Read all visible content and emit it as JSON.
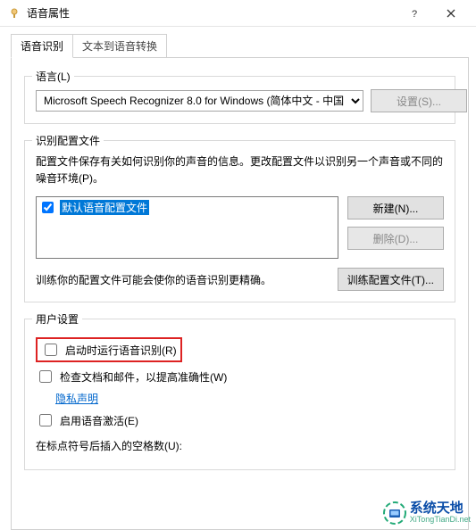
{
  "window": {
    "title": "语音属性"
  },
  "tabs": {
    "active": "语音识别",
    "inactive": "文本到语音转换"
  },
  "language_group": {
    "legend": "语言(L)",
    "recognizer": "Microsoft Speech Recognizer 8.0 for Windows (简体中文 - 中国",
    "settings_btn": "设置(S)..."
  },
  "profile_group": {
    "legend": "识别配置文件",
    "description": "配置文件保存有关如何识别你的声音的信息。更改配置文件以识别另一个声音或不同的噪音环境(P)。",
    "default_profile": "默认语音配置文件",
    "new_btn": "新建(N)...",
    "delete_btn": "删除(D)...",
    "train_desc": "训练你的配置文件可能会使你的语音识别更精确。",
    "train_btn": "训练配置文件(T)..."
  },
  "user_group": {
    "legend": "用户设置",
    "run_at_startup": "启动时运行语音识别(R)",
    "review_docs": "检查文档和邮件，以提高准确性(W)",
    "privacy_link": "隐私声明",
    "voice_activation": "启用语音激活(E)",
    "spaces_after_punct": "在标点符号后插入的空格数(U):"
  },
  "watermark": {
    "brand": "系统天地",
    "url": "XiTongTianDi.net"
  }
}
